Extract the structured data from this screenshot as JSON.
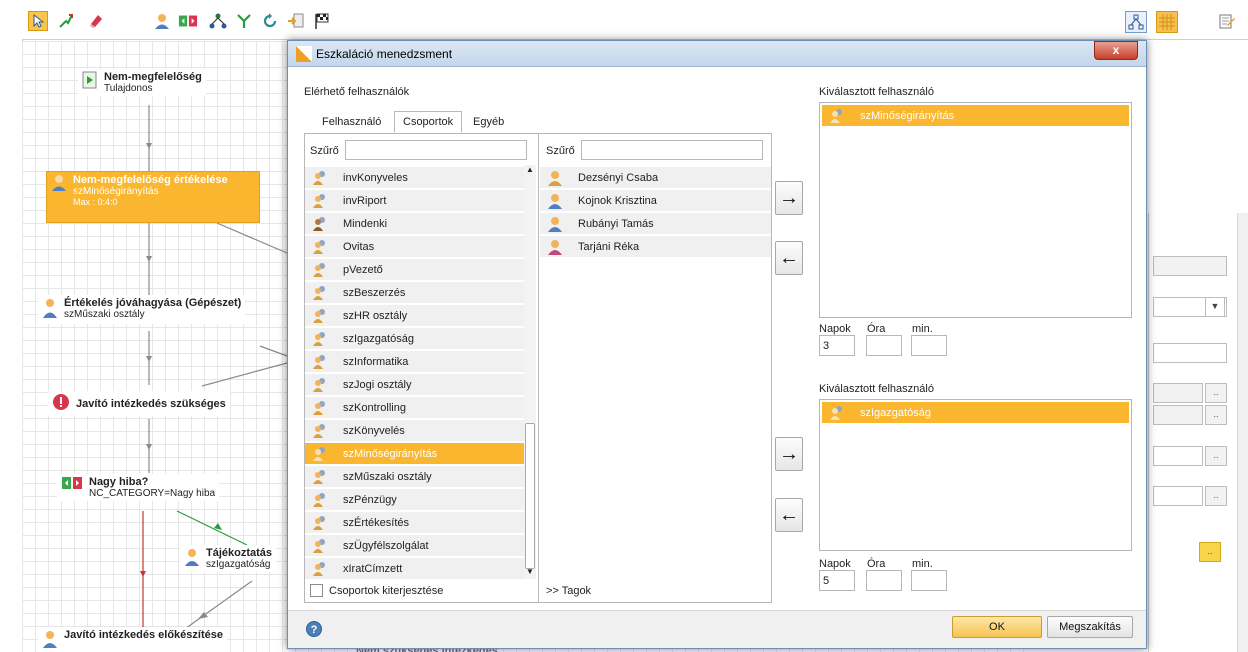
{
  "toolbar": {
    "icons": [
      "pointer-icon",
      "connector-icon",
      "eraser-icon",
      "user-task-icon",
      "decision-icon",
      "group-icon",
      "split-icon",
      "loop-icon",
      "import-icon",
      "finish-flag-icon",
      "layout-icon",
      "grid-icon",
      "edit-icon"
    ]
  },
  "workflow": {
    "nodes": [
      {
        "title": "Nem-megfelelőség",
        "sub": "Tulajdonos"
      },
      {
        "title": "Nem-megfelelőség értékelése",
        "sub": "szMinőségirányítás",
        "extra": "Max : 0:4:0"
      },
      {
        "title": "Értékelés jóváhagyása (Gépészet)",
        "sub": "szMűszaki osztály"
      },
      {
        "title": "Javító intézkedés szükséges",
        "sub": ""
      },
      {
        "title": "Nagy hiba?",
        "sub": "NC_CATEGORY=Nagy hiba"
      },
      {
        "title": "Tájékoztatás",
        "sub": "szIgazgatóság"
      },
      {
        "title": "Javító intézkedés előkészítése",
        "sub": ""
      }
    ],
    "partial_bottom": "Nem szükséges intézkedés"
  },
  "right_panel": {
    "dots": ".."
  },
  "dialog": {
    "title": "Eszkaláció menedzsment",
    "close_label": "x",
    "available_users_label": "Elérhető felhasználók",
    "tabs": [
      "Felhasználó",
      "Csoportok",
      "Egyéb"
    ],
    "active_tab": "Csoportok",
    "filter_label": "Szűrő",
    "filter_value": "",
    "groups": [
      "invKonyveles",
      "invRiport",
      "Mindenki",
      "Ovitas",
      "pVezető",
      "szBeszerzés",
      "szHR osztály",
      "szIgazgatóság",
      "szInformatika",
      "szJogi osztály",
      "szKontrolling",
      "szKönyvelés",
      "szMinőségirányítás",
      "szMűszaki osztály",
      "szPénzügy",
      "szÉrtékesítés",
      "szÜgyfélszolgálat",
      "xIratCímzett"
    ],
    "selected_group": "szMinőségirányítás",
    "members_filter_label": "Szűrő",
    "members": [
      "Dezsényi Csaba",
      "Kojnok Krisztina",
      "Rubányi Tamás",
      "Tarjáni Réka"
    ],
    "expand_groups_label": "Csoportok kiterjesztése",
    "members_link_label": ">>  Tagok",
    "selected_user_label_1": "Kiválasztott felhasználó",
    "selected_user_1": "szMinőségirányítás",
    "selected_user_label_2": "Kiválasztott felhasználó",
    "selected_user_2": "szIgazgatóság",
    "add_arrow": "→",
    "remove_arrow": "←",
    "time_labels": {
      "days": "Napok",
      "hours": "Óra",
      "minutes": "min."
    },
    "time_1": {
      "days": "3",
      "hours": "",
      "minutes": ""
    },
    "time_2": {
      "days": "5",
      "hours": "",
      "minutes": ""
    },
    "ok_label": "OK",
    "cancel_label": "Megszakítás",
    "help_label": "?"
  },
  "colors": {
    "accent": "#f9b62e",
    "title_bar": "#c4d6ec"
  }
}
